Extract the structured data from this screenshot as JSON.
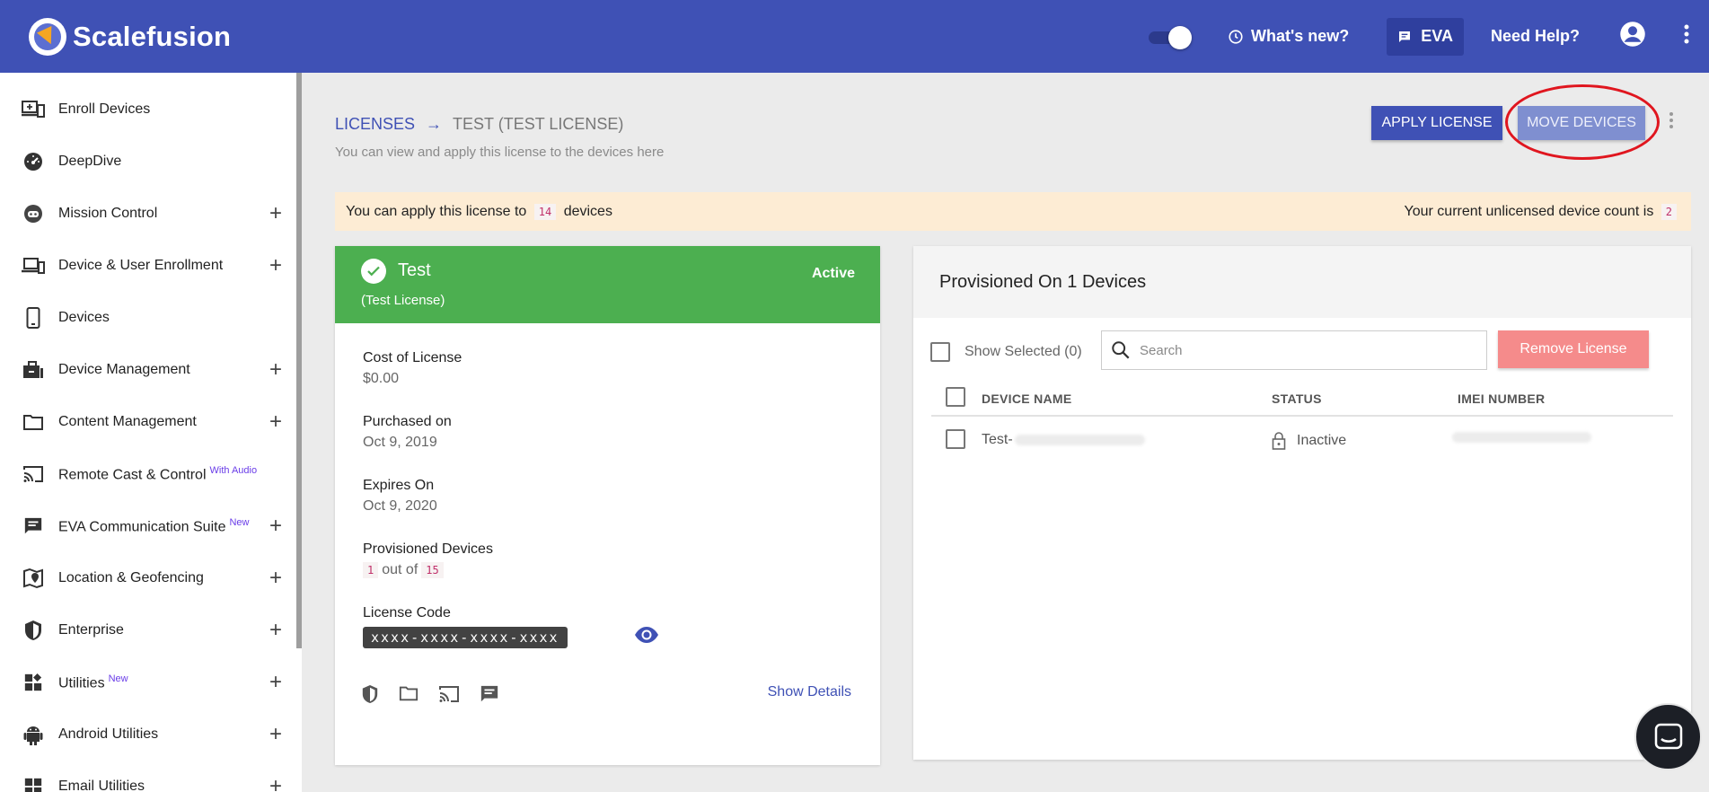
{
  "header": {
    "brand": "Scalefusion",
    "whats_new": "What's new?",
    "eva": "EVA",
    "need_help": "Need Help?"
  },
  "sidebar": {
    "items": [
      {
        "label": "Enroll Devices",
        "badge": "",
        "expandable": false,
        "icon": "enroll-devices-icon"
      },
      {
        "label": "DeepDive",
        "badge": "",
        "expandable": false,
        "icon": "speedometer-icon"
      },
      {
        "label": "Mission Control",
        "badge": "",
        "expandable": true,
        "icon": "mission-control-icon"
      },
      {
        "label": "Device & User Enrollment",
        "badge": "",
        "expandable": true,
        "icon": "devices-icon"
      },
      {
        "label": "Devices",
        "badge": "",
        "expandable": false,
        "icon": "phone-icon"
      },
      {
        "label": "Device Management",
        "badge": "",
        "expandable": true,
        "icon": "briefcase-icon"
      },
      {
        "label": "Content Management",
        "badge": "",
        "expandable": true,
        "icon": "folder-icon"
      },
      {
        "label": "Remote Cast & Control",
        "badge": "With Audio",
        "expandable": false,
        "icon": "cast-icon"
      },
      {
        "label": "EVA Communication Suite",
        "badge": "New",
        "expandable": true,
        "icon": "chat-icon"
      },
      {
        "label": "Location & Geofencing",
        "badge": "",
        "expandable": true,
        "icon": "map-pin-icon"
      },
      {
        "label": "Enterprise",
        "badge": "",
        "expandable": true,
        "icon": "shield-icon"
      },
      {
        "label": "Utilities",
        "badge": "New",
        "expandable": true,
        "icon": "widgets-icon"
      },
      {
        "label": "Android Utilities",
        "badge": "",
        "expandable": true,
        "icon": "android-icon"
      },
      {
        "label": "Email Utilities",
        "badge": "",
        "expandable": true,
        "icon": "email-icon"
      }
    ]
  },
  "breadcrumb": {
    "parent": "LICENSES",
    "current": "TEST (TEST LICENSE)"
  },
  "subtitle": "You can view and apply this license to the devices here",
  "actions": {
    "apply": "APPLY LICENSE",
    "move": "MOVE DEVICES"
  },
  "notice": {
    "left_prefix": "You can apply this license to",
    "left_count": "14",
    "left_suffix": "devices",
    "right_prefix": "Your current unlicensed device count is",
    "right_count": "2"
  },
  "license": {
    "name": "Test",
    "sub": "(Test License)",
    "status": "Active",
    "cost_label": "Cost of License",
    "cost": "$0.00",
    "purchased_label": "Purchased on",
    "purchased": "Oct 9, 2019",
    "expires_label": "Expires On",
    "expires": "Oct 9, 2020",
    "provisioned_label": "Provisioned Devices",
    "provisioned_used": "1",
    "provisioned_of": "out of",
    "provisioned_total": "15",
    "code_label": "License Code",
    "code": "xxxx-xxxx-xxxx-xxxx",
    "show_details": "Show Details"
  },
  "devices_panel": {
    "title": "Provisioned On 1 Devices",
    "show_selected": "Show Selected (0)",
    "search_placeholder": "Search",
    "remove_button": "Remove License",
    "columns": [
      "DEVICE NAME",
      "STATUS",
      "IMEI NUMBER"
    ],
    "rows": [
      {
        "device_name": "Test-",
        "status": "Inactive"
      }
    ]
  }
}
